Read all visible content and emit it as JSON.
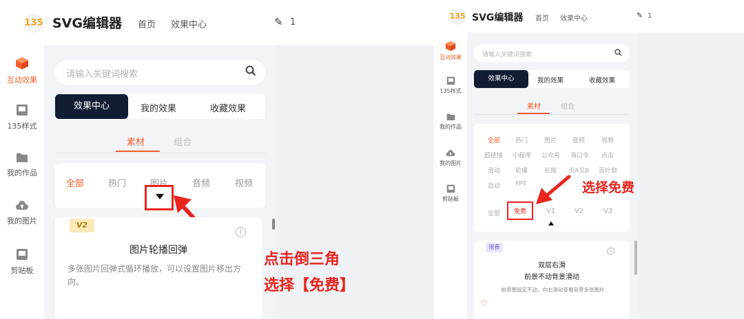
{
  "left": {
    "logo": "135",
    "app_title": "SVG编辑器",
    "nav": {
      "home": "首页",
      "effects": "效果中心"
    },
    "edit_count": "1",
    "sidebar": [
      {
        "label": "互动效果",
        "icon": "cube-icon"
      },
      {
        "label": "135样式",
        "icon": "style-icon"
      },
      {
        "label": "我的作品",
        "icon": "folder-icon"
      },
      {
        "label": "我的图片",
        "icon": "cloud-upload-icon"
      },
      {
        "label": "剪贴板",
        "icon": "clipboard-icon"
      }
    ],
    "search_placeholder": "请输入关键词搜索",
    "tabs": [
      "效果中心",
      "我的效果",
      "收藏效果"
    ],
    "subtabs": [
      "素材",
      "组合"
    ],
    "filters": [
      "全部",
      "热门",
      "图片",
      "音频",
      "视频"
    ],
    "card": {
      "badge": "V2",
      "title": "图片轮播回弹",
      "desc": "多张图片回弹式循环播放，可以设置图片移出方向。"
    },
    "annotation": [
      "点击倒三角",
      "选择【免费】"
    ]
  },
  "right": {
    "logo": "135",
    "app_title": "SVG编辑器",
    "nav": {
      "home": "首页",
      "effects": "效果中心"
    },
    "edit_count": "1",
    "sidebar": [
      {
        "label": "互动效果",
        "icon": "cube-icon"
      },
      {
        "label": "135样式",
        "icon": "style-icon"
      },
      {
        "label": "我的作品",
        "icon": "folder-icon"
      },
      {
        "label": "我的图片",
        "icon": "cloud-upload-icon"
      },
      {
        "label": "剪贴板",
        "icon": "clipboard-icon"
      }
    ],
    "search_placeholder": "请输入关键词搜索",
    "tabs": [
      "效果中心",
      "我的效果",
      "收藏效果"
    ],
    "subtabs": [
      "素材",
      "组合"
    ],
    "filter_rows": [
      [
        "全部",
        "热门",
        "图片",
        "音频",
        "视频"
      ],
      [
        "超链接",
        "小程序",
        "公众号",
        "海口令",
        "点击"
      ],
      [
        "滑动",
        "轮播",
        "长按",
        "点A见B",
        "百叶窗"
      ],
      [
        "自动",
        "PPT"
      ]
    ],
    "price_filters": [
      "全部",
      "免费",
      "V1",
      "V2",
      "V3"
    ],
    "card": {
      "badge": "限费",
      "title": "双层右滑",
      "subtitle": "前景不动背景滑动",
      "desc": "前景图固定不动，向右滑动查看背景多张图片"
    },
    "annotation": "选择免费"
  },
  "colors": {
    "accent": "#f25d2a",
    "annotation_red": "#e8251f",
    "dark_tab": "#111d33"
  }
}
